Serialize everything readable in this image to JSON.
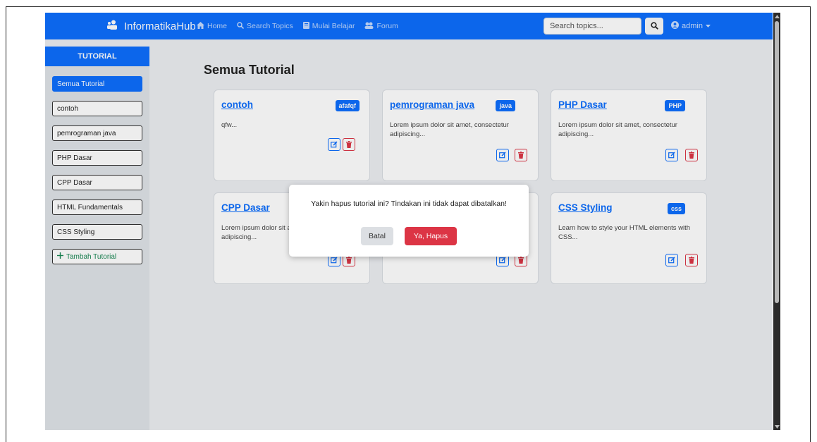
{
  "colors": {
    "primary": "#0d6efd",
    "danger": "#dc3545",
    "success": "#198754"
  },
  "navbar": {
    "brand": "InformatikaHub",
    "links": [
      {
        "label": "Home",
        "icon": "home-icon"
      },
      {
        "label": "Search Topics",
        "icon": "search-icon"
      },
      {
        "label": "Mulai Belajar",
        "icon": "book-icon"
      },
      {
        "label": "Forum",
        "icon": "users-icon"
      }
    ],
    "search_placeholder": "Search topics...",
    "user": "admin"
  },
  "sidebar": {
    "header": "TUTORIAL",
    "items": [
      "Semua Tutorial",
      "contoh",
      "pemrograman java",
      "PHP Dasar",
      "CPP Dasar",
      "HTML Fundamentals",
      "CSS Styling"
    ],
    "active": "Semua Tutorial",
    "add_label": "Tambah Tutorial"
  },
  "main": {
    "title": "Semua Tutorial",
    "cards": [
      {
        "title": "contoh",
        "badge": "afafqf",
        "desc": "qfw..."
      },
      {
        "title": "pemrograman java",
        "badge": "java",
        "desc": "Lorem ipsum dolor sit amet, consectetur adipiscing..."
      },
      {
        "title": "PHP Dasar",
        "badge": "PHP",
        "desc": "Lorem ipsum dolor sit amet, consectetur adipiscing..."
      },
      {
        "title": "CPP Dasar",
        "badge": "",
        "desc": "Lorem ipsum dolor sit amet, consectetur adipiscing..."
      },
      {
        "title": "",
        "badge": "",
        "desc": ""
      },
      {
        "title": "CSS Styling",
        "badge": "css",
        "desc": "Learn how to style your HTML elements with CSS..."
      }
    ]
  },
  "modal": {
    "message": "Yakin hapus tutorial ini? Tindakan ini tidak dapat dibatalkan!",
    "cancel_label": "Batal",
    "confirm_label": "Ya, Hapus"
  }
}
